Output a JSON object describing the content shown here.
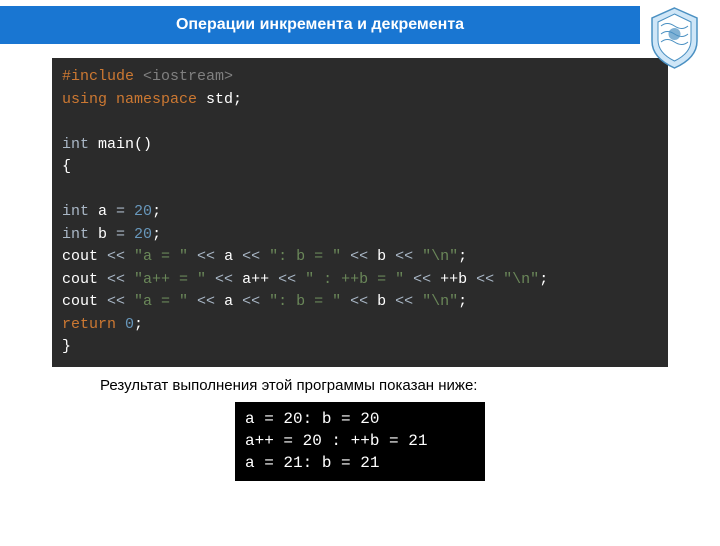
{
  "header": {
    "title": "Операции инкремента и декремента"
  },
  "code": {
    "lines": [
      {
        "segments": [
          {
            "t": "#include ",
            "c": "c-orange"
          },
          {
            "t": "<iostream>",
            "c": "c-include"
          }
        ]
      },
      {
        "segments": [
          {
            "t": "using namespace ",
            "c": "c-orange"
          },
          {
            "t": "std;",
            "c": "c-white"
          }
        ]
      },
      {
        "segments": [
          {
            "t": " ",
            "c": "c-op"
          }
        ]
      },
      {
        "segments": [
          {
            "t": "int ",
            "c": "c-type"
          },
          {
            "t": "main()",
            "c": "c-white"
          }
        ]
      },
      {
        "segments": [
          {
            "t": "{",
            "c": "c-white"
          }
        ]
      },
      {
        "segments": [
          {
            "t": " ",
            "c": "c-op"
          }
        ]
      },
      {
        "segments": [
          {
            "t": "int ",
            "c": "c-type"
          },
          {
            "t": "a ",
            "c": "c-white"
          },
          {
            "t": "= ",
            "c": "c-op"
          },
          {
            "t": "20",
            "c": "c-num"
          },
          {
            "t": ";",
            "c": "c-white"
          }
        ]
      },
      {
        "segments": [
          {
            "t": "int ",
            "c": "c-type"
          },
          {
            "t": "b ",
            "c": "c-white"
          },
          {
            "t": "= ",
            "c": "c-op"
          },
          {
            "t": "20",
            "c": "c-num"
          },
          {
            "t": ";",
            "c": "c-white"
          }
        ]
      },
      {
        "segments": [
          {
            "t": "cout ",
            "c": "c-white"
          },
          {
            "t": "<< ",
            "c": "c-op"
          },
          {
            "t": "\"a = \" ",
            "c": "c-str"
          },
          {
            "t": "<< ",
            "c": "c-op"
          },
          {
            "t": "a ",
            "c": "c-white"
          },
          {
            "t": "<< ",
            "c": "c-op"
          },
          {
            "t": "\": b = \" ",
            "c": "c-str"
          },
          {
            "t": "<< ",
            "c": "c-op"
          },
          {
            "t": "b ",
            "c": "c-white"
          },
          {
            "t": "<< ",
            "c": "c-op"
          },
          {
            "t": "\"\\n\"",
            "c": "c-str"
          },
          {
            "t": ";",
            "c": "c-white"
          }
        ]
      },
      {
        "segments": [
          {
            "t": "cout ",
            "c": "c-white"
          },
          {
            "t": "<< ",
            "c": "c-op"
          },
          {
            "t": "\"a++ = \" ",
            "c": "c-str"
          },
          {
            "t": "<< ",
            "c": "c-op"
          },
          {
            "t": "a++ ",
            "c": "c-white"
          },
          {
            "t": "<< ",
            "c": "c-op"
          },
          {
            "t": "\" : ++b = \" ",
            "c": "c-str"
          },
          {
            "t": "<< ",
            "c": "c-op"
          },
          {
            "t": "++b ",
            "c": "c-white"
          },
          {
            "t": "<< ",
            "c": "c-op"
          },
          {
            "t": "\"\\n\"",
            "c": "c-str"
          },
          {
            "t": ";",
            "c": "c-white"
          }
        ]
      },
      {
        "segments": [
          {
            "t": "cout ",
            "c": "c-white"
          },
          {
            "t": "<< ",
            "c": "c-op"
          },
          {
            "t": "\"a = \" ",
            "c": "c-str"
          },
          {
            "t": "<< ",
            "c": "c-op"
          },
          {
            "t": "a ",
            "c": "c-white"
          },
          {
            "t": "<< ",
            "c": "c-op"
          },
          {
            "t": "\": b = \" ",
            "c": "c-str"
          },
          {
            "t": "<< ",
            "c": "c-op"
          },
          {
            "t": "b ",
            "c": "c-white"
          },
          {
            "t": "<< ",
            "c": "c-op"
          },
          {
            "t": "\"\\n\"",
            "c": "c-str"
          },
          {
            "t": ";",
            "c": "c-white"
          }
        ]
      },
      {
        "segments": [
          {
            "t": "return ",
            "c": "c-orange"
          },
          {
            "t": "0",
            "c": "c-num"
          },
          {
            "t": ";",
            "c": "c-white"
          }
        ]
      },
      {
        "segments": [
          {
            "t": "}",
            "c": "c-white"
          }
        ]
      }
    ]
  },
  "result": {
    "caption": "Результат выполнения этой программы показан ниже:",
    "lines": [
      "a = 20: b = 20",
      "a++ = 20 : ++b = 21",
      "a = 21: b = 21"
    ]
  }
}
